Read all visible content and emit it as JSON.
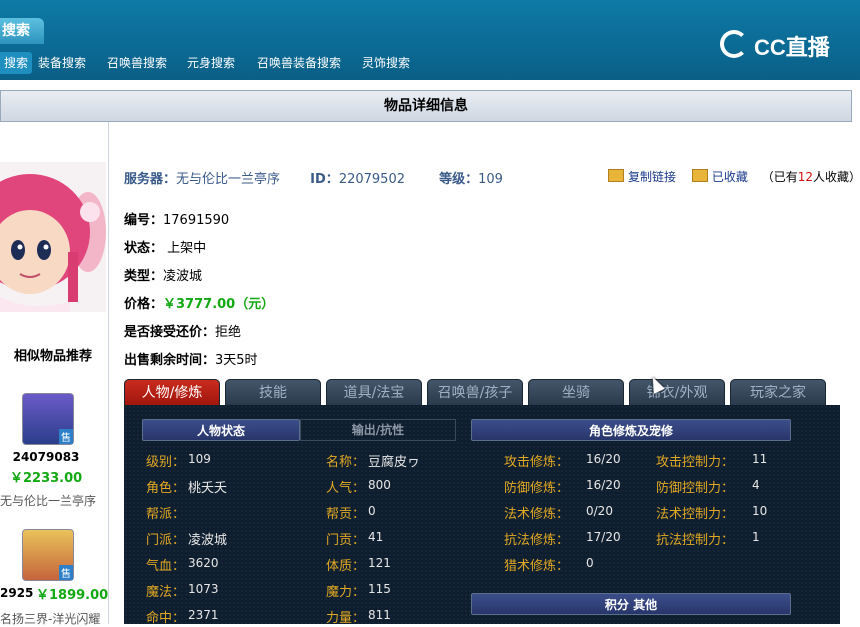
{
  "top": {
    "tab_label": "搜索",
    "nav": [
      "搜索",
      "装备搜索",
      "召唤兽搜索",
      "元身搜索",
      "召唤兽装备搜索",
      "灵饰搜索"
    ],
    "logo_text": "CC直播"
  },
  "page_title": "物品详细信息",
  "left": {
    "similar_title": "相似物品推荐",
    "items": [
      {
        "id": "24079083",
        "price": "￥2233.00",
        "server": "无与伦比一兰亭序",
        "badge": "售"
      },
      {
        "id": "2925",
        "price": "￥1899.00",
        "server": "名扬三界-洋光闪耀",
        "badge": "售"
      }
    ]
  },
  "header": {
    "server_label": "服务器：",
    "server_value": "无与伦比一兰亭序",
    "id_label": "ID：",
    "id_value": "22079502",
    "level_label": "等级：",
    "level_value": "109",
    "copy_link": "复制链接",
    "favorited": "已收藏",
    "fav_count_prefix": "（已有",
    "fav_count": "12",
    "fav_count_suffix": "人收藏）"
  },
  "info": [
    {
      "k": "编号：",
      "v": "17691590"
    },
    {
      "k": "状态：",
      "v": " 上架中"
    },
    {
      "k": "类型：",
      "v": "凌波城"
    },
    {
      "k": "价格：",
      "v": "￥3777.00（元）"
    },
    {
      "k": "是否接受还价：",
      "v": "拒绝"
    },
    {
      "k": "出售剩余时间：",
      "v": "3天5时"
    }
  ],
  "tabs": [
    "人物/修炼",
    "技能",
    "道具/法宝",
    "召唤兽/孩子",
    "坐骑",
    "锦衣/外观",
    "玩家之家"
  ],
  "panel": {
    "subtab_active": "人物状态",
    "subtab_inactive": "输出/抗性",
    "cultivation_header": "角色修炼及宠修",
    "score_header": "积分 其他",
    "status": [
      {
        "k": "级别：",
        "v": "109"
      },
      {
        "k": "角色：",
        "v": "桃夭夭"
      },
      {
        "k": "帮派：",
        "v": ""
      },
      {
        "k": "门派：",
        "v": "凌波城"
      },
      {
        "k": "气血：",
        "v": "3620"
      },
      {
        "k": "魔法：",
        "v": "1073"
      },
      {
        "k": "命中：",
        "v": "2371"
      }
    ],
    "status2": [
      {
        "k": "名称：",
        "v": "豆腐皮ヮ"
      },
      {
        "k": "人气：",
        "v": "800"
      },
      {
        "k": "帮贡：",
        "v": "0"
      },
      {
        "k": "门贡：",
        "v": "41"
      },
      {
        "k": "体质：",
        "v": "121"
      },
      {
        "k": "魔力：",
        "v": "115"
      },
      {
        "k": "力量：",
        "v": "811"
      }
    ],
    "cultivation": [
      {
        "k": "攻击修炼：",
        "v": "16/20"
      },
      {
        "k": "防御修炼：",
        "v": "16/20"
      },
      {
        "k": "法术修炼：",
        "v": "0/20"
      },
      {
        "k": "抗法修炼：",
        "v": "17/20"
      },
      {
        "k": "猎术修炼：",
        "v": "0"
      }
    ],
    "control": [
      {
        "k": "攻击控制力：",
        "v": "11"
      },
      {
        "k": "防御控制力：",
        "v": "4"
      },
      {
        "k": "法术控制力：",
        "v": "10"
      },
      {
        "k": "抗法控制力：",
        "v": "1"
      }
    ]
  }
}
